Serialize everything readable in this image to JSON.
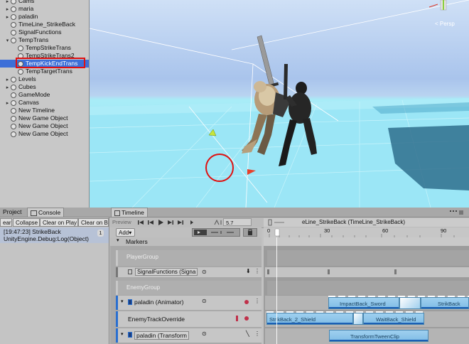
{
  "hierarchy": {
    "items": [
      {
        "label": "Cams",
        "indent": 1,
        "arrow": "▸",
        "icon": true
      },
      {
        "label": "maria",
        "indent": 1,
        "arrow": "▸",
        "icon": true
      },
      {
        "label": "paladin",
        "indent": 1,
        "arrow": "▸",
        "icon": true
      },
      {
        "label": "TimeLine_StrikeBack",
        "indent": 1,
        "arrow": "",
        "icon": true
      },
      {
        "label": "SignalFunctions",
        "indent": 1,
        "arrow": "",
        "icon": true
      },
      {
        "label": "TempTrans",
        "indent": 1,
        "arrow": "▾",
        "icon": true
      },
      {
        "label": "TempStrikeTrans",
        "indent": 2,
        "arrow": "",
        "icon": true
      },
      {
        "label": "TempStrikeTrans2",
        "indent": 2,
        "arrow": "",
        "icon": true
      },
      {
        "label": "TempKickEndTrans",
        "indent": 2,
        "arrow": "",
        "icon": true,
        "selected": true
      },
      {
        "label": "TempTargetTrans",
        "indent": 2,
        "arrow": "",
        "icon": true
      },
      {
        "label": "Levels",
        "indent": 1,
        "arrow": "▸",
        "icon": true
      },
      {
        "label": "Cubes",
        "indent": 1,
        "arrow": "▸",
        "icon": true
      },
      {
        "label": "GameMode",
        "indent": 1,
        "arrow": "",
        "icon": true
      },
      {
        "label": "Canvas",
        "indent": 1,
        "arrow": "▸",
        "icon": true
      },
      {
        "label": "New Timeline",
        "indent": 1,
        "arrow": "",
        "icon": true
      },
      {
        "label": "New Game Object",
        "indent": 1,
        "arrow": "",
        "icon": true
      },
      {
        "label": "New Game Object",
        "indent": 1,
        "arrow": "",
        "icon": true
      },
      {
        "label": "New Game Object",
        "indent": 1,
        "arrow": "",
        "icon": true
      }
    ]
  },
  "scene": {
    "persp_label": "< Persp",
    "gizmo_y": "y"
  },
  "tabs": {
    "project": "Project",
    "console": "Console",
    "timeline": "Timeline"
  },
  "console": {
    "clear": "ear",
    "collapse": "Collapse",
    "clear_on_play": "Clear on Play",
    "clear_on_build": "Clear on Bu",
    "log_line1": "[19:47:23] StrikeBack",
    "log_line2": "UnityEngine.Debug:Log(Object)",
    "log_count": "1"
  },
  "timeline": {
    "preview": "Preview",
    "frame": "5.7",
    "add_label": "Add",
    "asset_title": "eLine_StrikeBack (TimeLine_StrikeBack)",
    "ruler": [
      "0",
      "30",
      "60",
      "90"
    ],
    "markers_label": "Markers",
    "tracks": {
      "player_group": "PlayerGroup",
      "signal_track": "SignalFunctions (Signa",
      "enemy_group": "EnemyGroup",
      "animator_track": "paladin (Animator)",
      "override_track": "EnemyTrackOverride",
      "transform_track": "paladin (Transform"
    },
    "clips": {
      "impact_back_sword": "ImpactBack_Sword",
      "strike_back": "StrikBack",
      "strike_back_2_shield": "StrikBack_2_Shield",
      "wait_back_shield": "WaitBack_Shield",
      "transform_tween": "TransformTweenClip"
    }
  }
}
